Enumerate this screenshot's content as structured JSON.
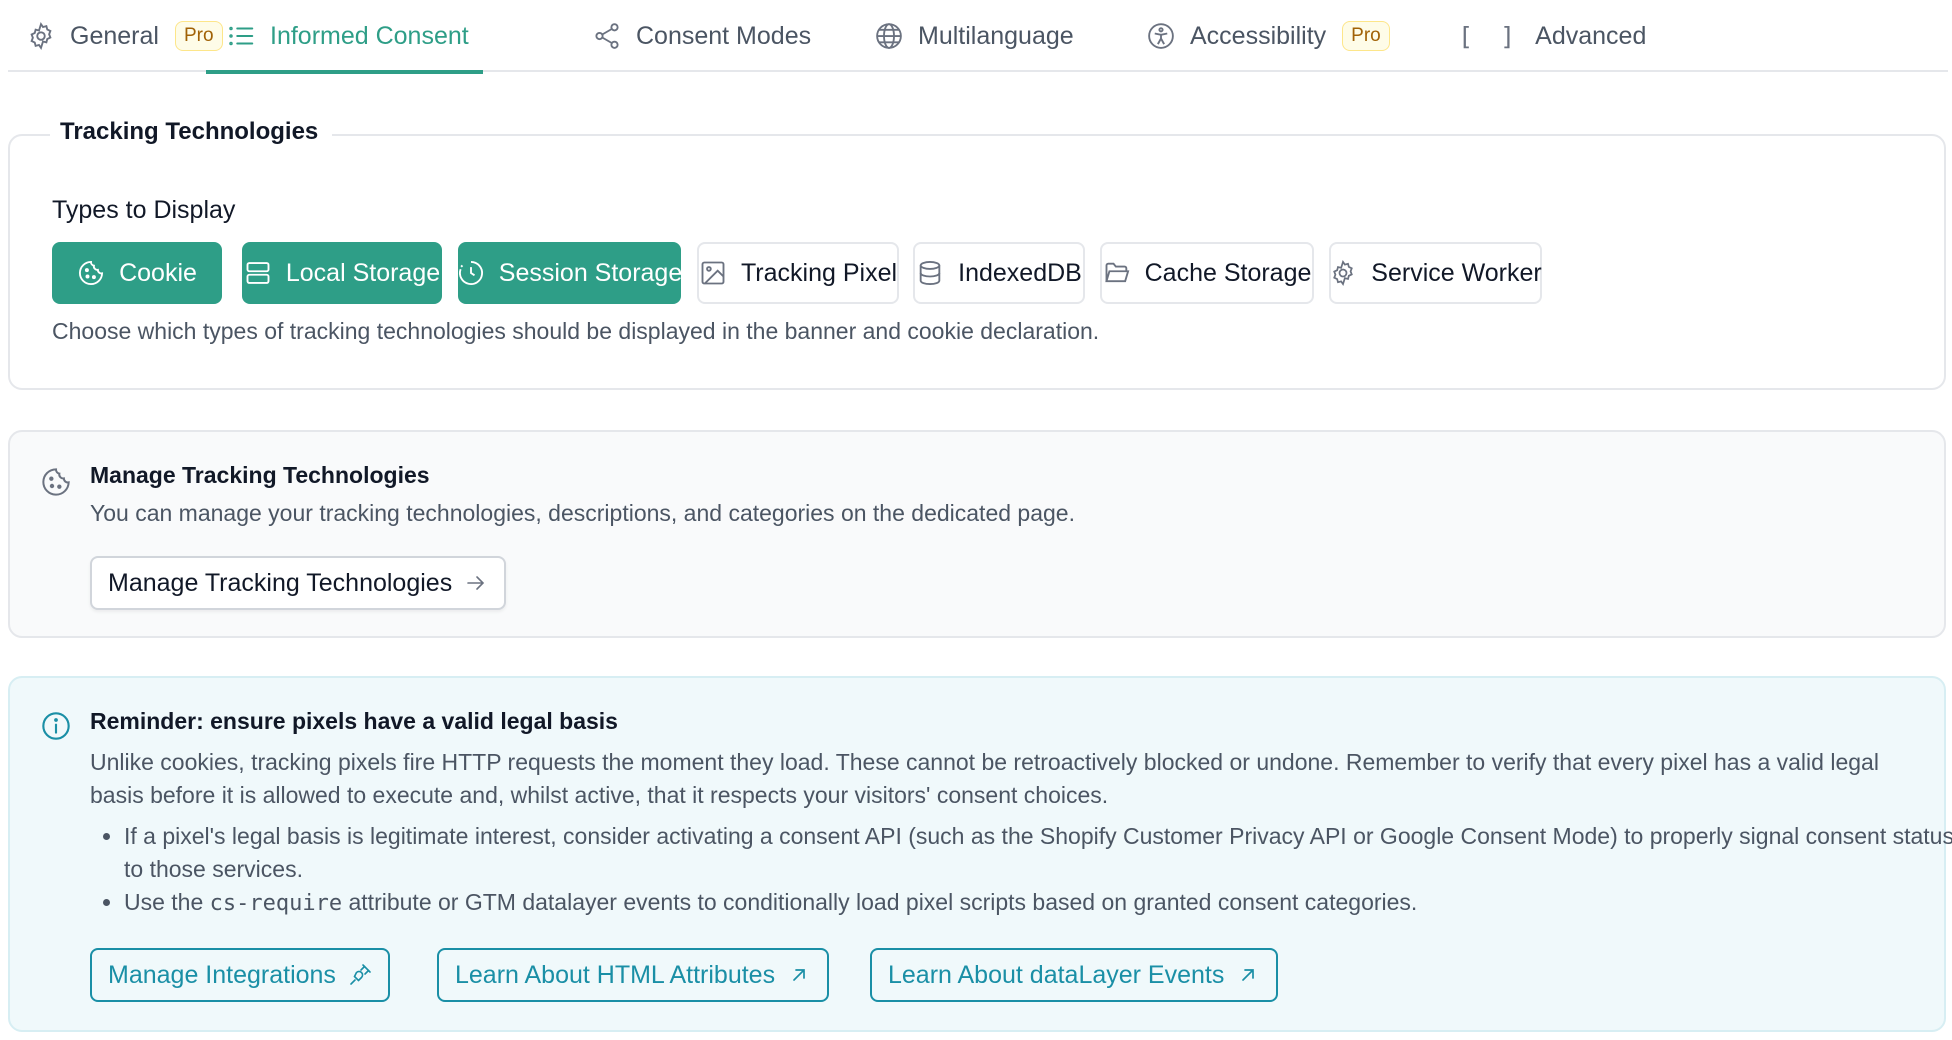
{
  "tabs": [
    {
      "label": "General",
      "icon": "gear-icon",
      "badge": "Pro"
    },
    {
      "label": "Informed Consent",
      "icon": "list-icon",
      "active": true
    },
    {
      "label": "Consent Modes",
      "icon": "share-icon"
    },
    {
      "label": "Multilanguage",
      "icon": "globe-icon"
    },
    {
      "label": "Accessibility",
      "icon": "accessibility-icon",
      "badge": "Pro"
    },
    {
      "label": "Advanced",
      "icon": "brackets-icon",
      "icon_text": "[ ]"
    }
  ],
  "tracking": {
    "legend": "Tracking Technologies",
    "types_label": "Types to Display",
    "types": [
      {
        "label": "Cookie",
        "icon": "cookie-icon",
        "selected": true
      },
      {
        "label": "Local Storage",
        "icon": "server-icon",
        "selected": true
      },
      {
        "label": "Session Storage",
        "icon": "clock-icon",
        "selected": true
      },
      {
        "label": "Tracking Pixel",
        "icon": "image-icon",
        "selected": false
      },
      {
        "label": "IndexedDB",
        "icon": "database-icon",
        "selected": false
      },
      {
        "label": "Cache Storage",
        "icon": "folder-open-icon",
        "selected": false
      },
      {
        "label": "Service Worker",
        "icon": "gear-icon",
        "selected": false
      }
    ],
    "help": "Choose which types of tracking technologies should be displayed in the banner and cookie declaration."
  },
  "manage": {
    "icon": "cookie-icon",
    "title": "Manage Tracking Technologies",
    "description": "You can manage your tracking technologies, descriptions, and categories on the dedicated page.",
    "button_label": "Manage Tracking Technologies",
    "button_icon": "arrow-right-icon"
  },
  "reminder": {
    "icon": "info-icon",
    "title": "Reminder: ensure pixels have a valid legal basis",
    "text": "Unlike cookies, tracking pixels fire HTTP requests the moment they load. These cannot be retroactively blocked or undone. Remember to verify that every pixel has a valid legal basis before it is allowed to execute and, whilst active, that it respects your visitors' consent choices.",
    "bullet1": "If a pixel's legal basis is legitimate interest, consider activating a consent API (such as the Shopify Customer Privacy API or Google Consent Mode) to properly signal consent status to those services.",
    "bullet2_before": "Use the ",
    "bullet2_code": "cs-require",
    "bullet2_after": " attribute or GTM datalayer events to conditionally load pixel scripts based on granted consent categories.",
    "buttons": [
      {
        "label": "Manage Integrations",
        "icon": "plug-icon"
      },
      {
        "label": "Learn About HTML Attributes",
        "icon": "external-arrow-icon"
      },
      {
        "label": "Learn About dataLayer Events",
        "icon": "external-arrow-icon"
      }
    ]
  },
  "colors": {
    "accent": "#2e9e87",
    "info": "#1a8fa6",
    "pro_text": "#a16207"
  }
}
